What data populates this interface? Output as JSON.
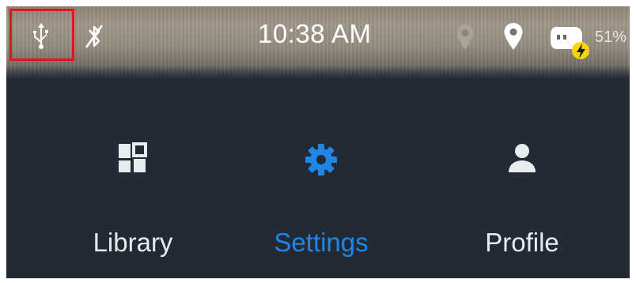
{
  "status_bar": {
    "time": "10:38 AM",
    "battery_percent": "51%",
    "icons": [
      "usb-icon",
      "bluetooth-off-icon",
      "location-off-icon",
      "location-icon",
      "battery-charging-icon"
    ]
  },
  "bottom_nav": {
    "items": [
      {
        "label": "Library",
        "icon": "grid-icon",
        "active": false
      },
      {
        "label": "Settings",
        "icon": "gear-icon",
        "active": true
      },
      {
        "label": "Profile",
        "icon": "person-icon",
        "active": false
      }
    ]
  },
  "colors": {
    "accent": "#1f86e5",
    "nav_background": "#222a36",
    "highlight_box": "#e0151b"
  }
}
